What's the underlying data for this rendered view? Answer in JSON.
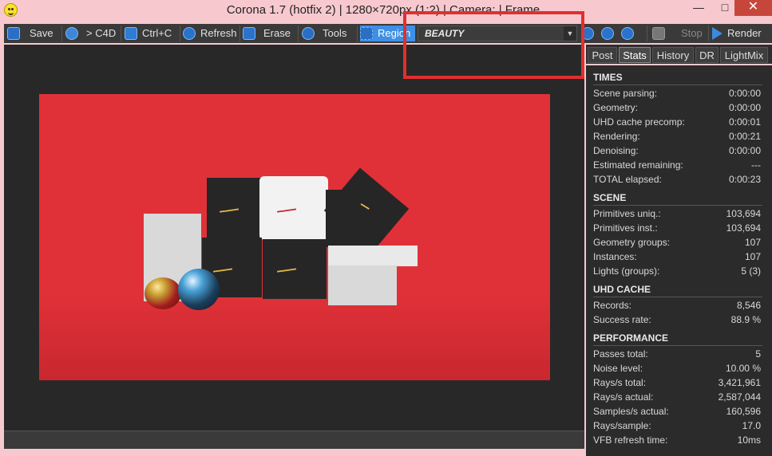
{
  "window": {
    "title": "Corona 1.7 (hotfix 2) | 1280×720px (1:2) | Camera:  | Frame",
    "minimize": "—",
    "maximize": "□",
    "close": "✕"
  },
  "toolbar": {
    "save": "Save",
    "to_c4d": "> C4D",
    "copy": "Ctrl+C",
    "refresh": "Refresh",
    "erase": "Erase",
    "tools": "Tools",
    "region": "Region",
    "channel": "BEAUTY",
    "stop": "Stop",
    "render": "Render"
  },
  "tabs": [
    "Post",
    "Stats",
    "History",
    "DR",
    "LightMix"
  ],
  "active_tab": "Stats",
  "stats": {
    "times": {
      "title": "TIMES",
      "rows": [
        [
          "Scene parsing:",
          "0:00:00"
        ],
        [
          "Geometry:",
          "0:00:00"
        ],
        [
          "UHD cache precomp:",
          "0:00:01"
        ],
        [
          "Rendering:",
          "0:00:21"
        ],
        [
          "Denoising:",
          "0:00:00"
        ],
        [
          "Estimated remaining:",
          "---"
        ],
        [
          "TOTAL elapsed:",
          "0:00:23"
        ]
      ]
    },
    "scene": {
      "title": "SCENE",
      "rows": [
        [
          "Primitives uniq.:",
          "103,694"
        ],
        [
          "Primitives inst.:",
          "103,694"
        ],
        [
          "Geometry groups:",
          "107"
        ],
        [
          "Instances:",
          "107"
        ],
        [
          "Lights (groups):",
          "5 (3)"
        ]
      ]
    },
    "uhd": {
      "title": "UHD CACHE",
      "rows": [
        [
          "Records:",
          "8,546"
        ],
        [
          "Success rate:",
          "88.9 %"
        ]
      ]
    },
    "performance": {
      "title": "PERFORMANCE",
      "rows": [
        [
          "Passes total:",
          "5"
        ],
        [
          "Noise level:",
          "10.00 %"
        ],
        [
          "Rays/s total:",
          "3,421,961"
        ],
        [
          "Rays/s actual:",
          "2,587,044"
        ],
        [
          "Samples/s actual:",
          "160,596"
        ],
        [
          "Rays/sample:",
          "17.0"
        ],
        [
          "VFB refresh time:",
          "10ms"
        ]
      ]
    }
  },
  "colors": {
    "background_frame": "#f7c9cf",
    "render_backdrop": "#e03138",
    "accent": "#3f8fe6",
    "annotation": "#e0302f"
  }
}
